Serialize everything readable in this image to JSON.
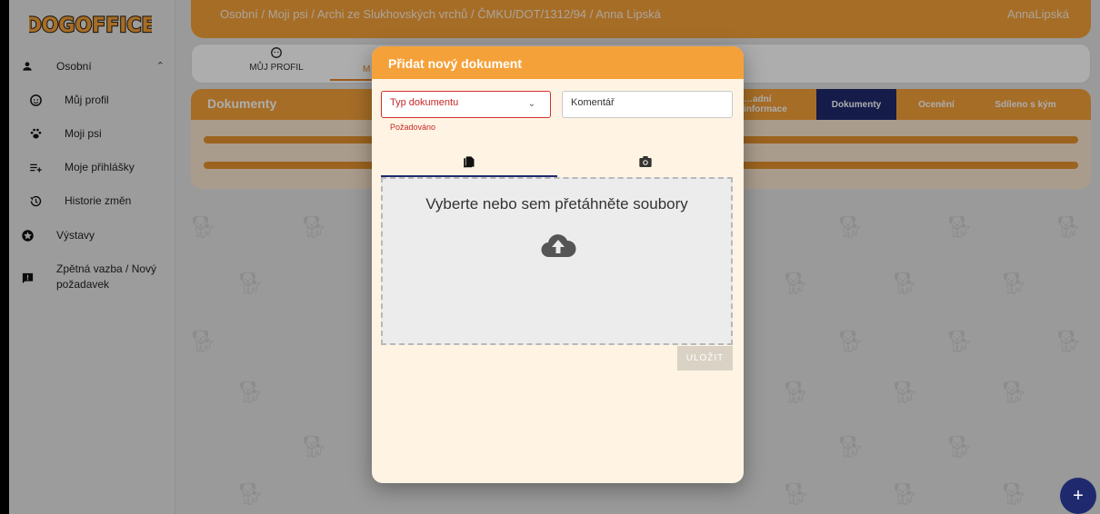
{
  "app": {
    "logo_text": "DOGOFFICE"
  },
  "sidebar": {
    "items": [
      {
        "label": "Osobní",
        "icon": "person-icon"
      },
      {
        "label": "Můj profil",
        "icon": "face-icon"
      },
      {
        "label": "Moji psi",
        "icon": "paw-icon"
      },
      {
        "label": "Moje přihlášky",
        "icon": "playlist-add-icon"
      },
      {
        "label": "Historie změn",
        "icon": "history-icon"
      },
      {
        "label": "Výstavy",
        "icon": "star-circle-icon"
      },
      {
        "label": "Zpětná vazba / Nový požadavek",
        "label_line1": "Zpětná vazba / Nový",
        "label_line2": "požadavek",
        "icon": "feedback-icon"
      }
    ]
  },
  "topbar": {
    "breadcrumb": "Osobní / Moji psi / Archi ze Slukhovských vrchů / ČMKU/DOT/1312/94 / Anna Lipská",
    "user": "AnnaLipská"
  },
  "profile_tabs": {
    "profile": "MŮJ PROFIL",
    "second_partial": "M"
  },
  "documents": {
    "title": "Dokumenty",
    "subtabs": [
      "…adní informace",
      "Dokumenty",
      "Ocenění",
      "Sdíleno s kým"
    ],
    "active_subtab": "Dokumenty"
  },
  "dialog": {
    "title": "Přidat nový dokument",
    "type_field": {
      "placeholder": "Typ dokumentu",
      "error": "Požadováno"
    },
    "comment_field": {
      "placeholder": "Komentář"
    },
    "tabs": [
      {
        "icon": "file-copy-icon"
      },
      {
        "icon": "camera-icon"
      }
    ],
    "dropzone_text": "Vyberte nebo sem přetáhněte soubory",
    "save_label": "ULOŽIT"
  },
  "fab_label": "+",
  "colors": {
    "primary": "#f5a13a",
    "accent": "#1f2a6e",
    "error": "#d32f2f",
    "panel": "#fbe6cf"
  }
}
